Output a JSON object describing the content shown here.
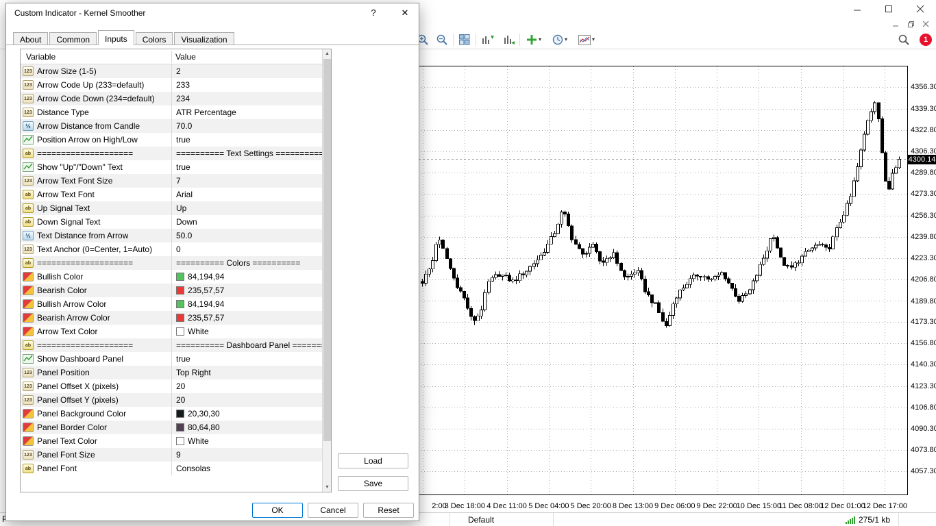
{
  "window": {
    "statusbar": {
      "hint": "F",
      "profile": "Default",
      "traffic": "275/1 kb",
      "badge_count": "1"
    }
  },
  "colors": {
    "accent": "#0078d7",
    "badge": "#e8112d",
    "grid": "#ababab",
    "bullish": "#54c25e",
    "bearish": "#eb3939",
    "signal_green": "#2f9e2f"
  },
  "icon_text": {
    "int": "123",
    "double": "½",
    "string": "ab"
  },
  "dialog": {
    "title": "Custom Indicator - Kernel Smoother",
    "help_glyph": "?",
    "close_glyph": "✕",
    "tabs": [
      {
        "label": "About"
      },
      {
        "label": "Common"
      },
      {
        "label": "Inputs"
      },
      {
        "label": "Colors"
      },
      {
        "label": "Visualization"
      }
    ],
    "active_tab": "Inputs",
    "table": {
      "headers": [
        "Variable",
        "Value"
      ],
      "rows": [
        {
          "type": "int",
          "name": "Arrow Size (1-5)",
          "value": "2"
        },
        {
          "type": "int",
          "name": "Arrow Code Up (233=default)",
          "value": "233"
        },
        {
          "type": "int",
          "name": "Arrow Code Down (234=default)",
          "value": "234"
        },
        {
          "type": "int",
          "name": "Distance Type",
          "value": "ATR Percentage"
        },
        {
          "type": "double",
          "name": "Arrow Distance from Candle",
          "value": "70.0"
        },
        {
          "type": "bool",
          "name": "Position Arrow on High/Low",
          "value": "true"
        },
        {
          "type": "string",
          "name": "====================",
          "value": "========== Text Settings =========="
        },
        {
          "type": "bool",
          "name": "Show \"Up\"/\"Down\" Text",
          "value": "true"
        },
        {
          "type": "int",
          "name": "Arrow Text Font Size",
          "value": "7"
        },
        {
          "type": "string",
          "name": "Arrow Text Font",
          "value": "Arial"
        },
        {
          "type": "string",
          "name": "Up Signal Text",
          "value": "Up"
        },
        {
          "type": "string",
          "name": "Down Signal Text",
          "value": "Down"
        },
        {
          "type": "double",
          "name": "Text Distance from Arrow",
          "value": "50.0"
        },
        {
          "type": "int",
          "name": "Text Anchor (0=Center, 1=Auto)",
          "value": "0"
        },
        {
          "type": "string",
          "name": "====================",
          "value": "========== Colors =========="
        },
        {
          "type": "color",
          "name": "Bullish Color",
          "value": "84,194,94",
          "swatch": "#54c25e"
        },
        {
          "type": "color",
          "name": "Bearish Color",
          "value": "235,57,57",
          "swatch": "#eb3939"
        },
        {
          "type": "color",
          "name": "Bullish Arrow Color",
          "value": "84,194,94",
          "swatch": "#54c25e"
        },
        {
          "type": "color",
          "name": "Bearish Arrow Color",
          "value": "235,57,57",
          "swatch": "#eb3939"
        },
        {
          "type": "color",
          "name": "Arrow Text Color",
          "value": "White",
          "swatch": "#ffffff"
        },
        {
          "type": "string",
          "name": "====================",
          "value": "========== Dashboard Panel =========="
        },
        {
          "type": "bool",
          "name": "Show Dashboard Panel",
          "value": "true"
        },
        {
          "type": "int",
          "name": "Panel Position",
          "value": "Top Right"
        },
        {
          "type": "int",
          "name": "Panel Offset X (pixels)",
          "value": "20"
        },
        {
          "type": "int",
          "name": "Panel Offset Y (pixels)",
          "value": "20"
        },
        {
          "type": "color",
          "name": "Panel Background Color",
          "value": "20,30,30",
          "swatch": "#141e1e"
        },
        {
          "type": "color",
          "name": "Panel Border Color",
          "value": "80,64,80",
          "swatch": "#504050"
        },
        {
          "type": "color",
          "name": "Panel Text Color",
          "value": "White",
          "swatch": "#ffffff"
        },
        {
          "type": "int",
          "name": "Panel Font Size",
          "value": "9"
        },
        {
          "type": "string",
          "name": "Panel Font",
          "value": "Consolas"
        }
      ]
    },
    "buttons": {
      "load": "Load",
      "save": "Save",
      "ok": "OK",
      "cancel": "Cancel",
      "reset": "Reset"
    }
  },
  "chart": {
    "type": "candlestick",
    "current_price": "4300.14",
    "scale_top": 4373.0,
    "scale_bottom": 4038.6,
    "candle_count": 138,
    "price_labels": [
      "4356.30",
      "4339.30",
      "4322.80",
      "4306.30",
      "4289.80",
      "4273.30",
      "4256.30",
      "4239.80",
      "4223.30",
      "4206.80",
      "4189.80",
      "4173.30",
      "4156.80",
      "4140.30",
      "4123.30",
      "4106.80",
      "4090.30",
      "4073.80",
      "4057.30"
    ],
    "time_labels": [
      "2:00",
      "3 Dec 18:00",
      "4 Dec 11:00",
      "5 Dec 04:00",
      "5 Dec 20:00",
      "8 Dec 13:00",
      "9 Dec 06:00",
      "9 Dec 22:00",
      "10 Dec 15:00",
      "11 Dec 08:00",
      "12 Dec 01:00",
      "12 Dec 17:00"
    ],
    "keypoints": [
      [
        0,
        4205
      ],
      [
        0.02,
        4218
      ],
      [
        0.032,
        4240
      ],
      [
        0.048,
        4226
      ],
      [
        0.065,
        4208
      ],
      [
        0.09,
        4190
      ],
      [
        0.105,
        4173
      ],
      [
        0.122,
        4181
      ],
      [
        0.138,
        4204
      ],
      [
        0.16,
        4211
      ],
      [
        0.19,
        4205
      ],
      [
        0.22,
        4214
      ],
      [
        0.25,
        4226
      ],
      [
        0.275,
        4241
      ],
      [
        0.295,
        4261
      ],
      [
        0.315,
        4238
      ],
      [
        0.335,
        4225
      ],
      [
        0.355,
        4234
      ],
      [
        0.375,
        4219
      ],
      [
        0.4,
        4227
      ],
      [
        0.425,
        4207
      ],
      [
        0.45,
        4214
      ],
      [
        0.47,
        4196
      ],
      [
        0.49,
        4186
      ],
      [
        0.51,
        4169
      ],
      [
        0.53,
        4193
      ],
      [
        0.555,
        4204
      ],
      [
        0.58,
        4211
      ],
      [
        0.605,
        4206
      ],
      [
        0.63,
        4212
      ],
      [
        0.65,
        4199
      ],
      [
        0.665,
        4190
      ],
      [
        0.685,
        4197
      ],
      [
        0.705,
        4214
      ],
      [
        0.725,
        4232
      ],
      [
        0.735,
        4244
      ],
      [
        0.752,
        4222
      ],
      [
        0.77,
        4214
      ],
      [
        0.79,
        4222
      ],
      [
        0.81,
        4229
      ],
      [
        0.83,
        4234
      ],
      [
        0.85,
        4229
      ],
      [
        0.862,
        4239
      ],
      [
        0.878,
        4254
      ],
      [
        0.896,
        4268
      ],
      [
        0.915,
        4298
      ],
      [
        0.933,
        4330
      ],
      [
        0.952,
        4349
      ],
      [
        0.963,
        4305
      ],
      [
        0.975,
        4272
      ],
      [
        0.985,
        4291
      ],
      [
        1,
        4300.14
      ]
    ]
  }
}
